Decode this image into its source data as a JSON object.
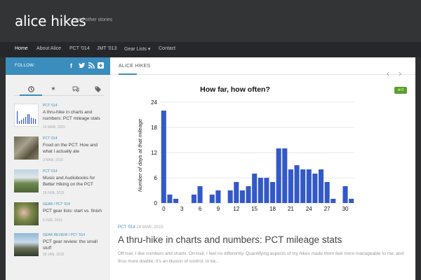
{
  "site": {
    "title": "alice hikes",
    "tagline": "and other stories"
  },
  "nav": {
    "items": [
      {
        "label": "Home"
      },
      {
        "label": "About Alice"
      },
      {
        "label": "PCT '014"
      },
      {
        "label": "JMT '013"
      },
      {
        "label": "Gear Lists ▾"
      },
      {
        "label": "Contact"
      }
    ]
  },
  "sidebar": {
    "follow_label": "FOLLOW:",
    "social_icons": [
      "facebook-icon",
      "twitter-icon",
      "rss-icon",
      "plus-icon"
    ],
    "tab_icons": [
      "clock-icon",
      "star-icon",
      "comments-icon",
      "tags-icon"
    ],
    "posts": [
      {
        "category": "PCT '014",
        "title": "A thru-hike in charts and numbers: PCT mileage stats",
        "date": "24 MAR, 2015"
      },
      {
        "category": "PCT '014",
        "title": "Food on the PCT: How and what I actually ate",
        "date": "3 MAR, 2015"
      },
      {
        "category": "PCT '014",
        "title": "Music and Audiobooks for Better Hiking on the PCT",
        "date": "18 FEB, 2015"
      },
      {
        "category": "GEAR / PCT '014",
        "title": "PCT gear lists: start vs. finish",
        "date": "5 FEB, 2015"
      },
      {
        "category": "GEAR REVIEW / PCT '014",
        "title": "PCT gear review: the small stuff",
        "date": "28 JAN, 2015"
      }
    ]
  },
  "main": {
    "section_label": "ALICE HIKES",
    "comment_count": "0",
    "post": {
      "category": "PCT '014",
      "date": "24 MAR, 2015",
      "title": "A thru-hike in charts and numbers: PCT mileage stats",
      "excerpt": "Off-trail, I like numbers and charts. On-trail, I feel no differently. Quantifying aspects of my hikes made them feel more manageable to me, and thus more doable. It's an illusion of control, to be..."
    }
  },
  "colors": {
    "accent": "#3b8dbd",
    "bar": "#3359c8",
    "badge": "#5aa02c"
  },
  "chart_data": {
    "type": "bar",
    "title": "How far, how often?",
    "ylabel": "Number of days at that mileage",
    "xlabel": "",
    "ylim": [
      0,
      24
    ],
    "yticks": [
      0,
      6,
      12,
      18,
      24
    ],
    "xlim": [
      0,
      32
    ],
    "xticks": [
      0,
      3,
      6,
      9,
      12,
      15,
      18,
      21,
      24,
      27,
      30
    ],
    "x": [
      0,
      1,
      2,
      3,
      4,
      5,
      6,
      7,
      8,
      9,
      10,
      11,
      12,
      13,
      14,
      15,
      16,
      17,
      18,
      19,
      20,
      21,
      22,
      23,
      24,
      25,
      26,
      27,
      28,
      29,
      30,
      31
    ],
    "values": [
      22,
      2,
      1,
      0,
      0,
      2,
      4,
      0,
      2,
      3,
      0,
      3,
      5,
      3,
      4,
      7,
      6,
      6,
      5,
      13,
      13,
      8,
      9,
      8,
      8,
      7,
      8,
      5,
      1,
      0,
      4,
      1
    ]
  }
}
